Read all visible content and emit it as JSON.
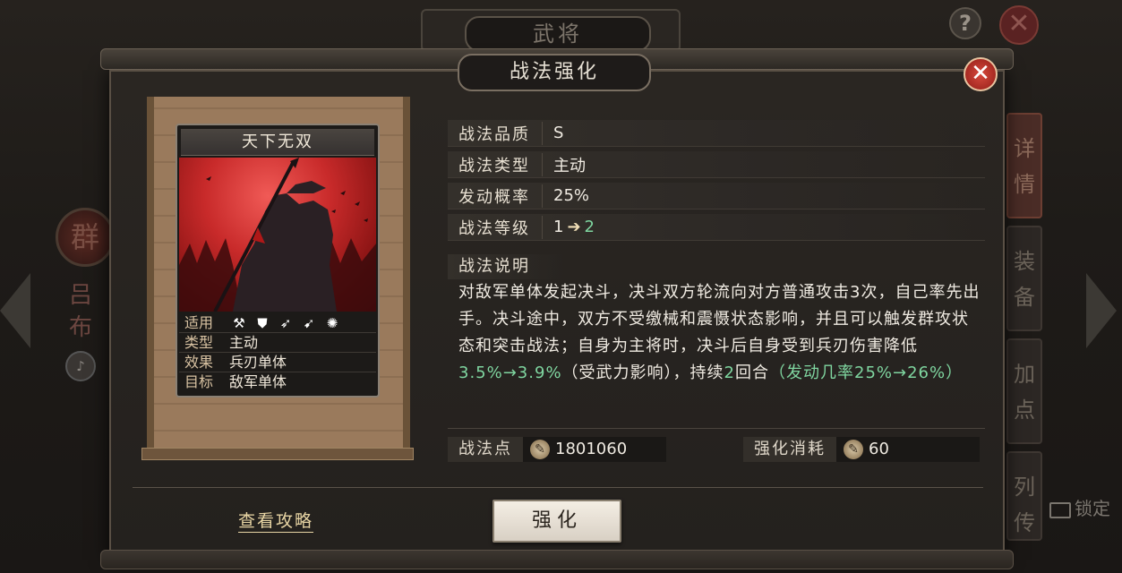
{
  "background": {
    "top_tab_title": "武将",
    "help_symbol": "?",
    "close_symbol": "✕",
    "faction": "群",
    "hero_name": "吕布",
    "side_tabs": [
      "详情",
      "装备",
      "加点",
      "列传"
    ],
    "lock_label": "锁定"
  },
  "modal": {
    "title": "战法强化",
    "close_symbol": "✕"
  },
  "card": {
    "name": "天下无双",
    "icons": [
      "axe-icon",
      "shield-icon",
      "bow-icon",
      "spear-icon",
      "wheel-icon"
    ],
    "stats": [
      {
        "key": "适用",
        "value": ""
      },
      {
        "key": "类型",
        "value": "主动"
      },
      {
        "key": "效果",
        "value": "兵刃单体"
      },
      {
        "key": "目标",
        "value": "敌军单体"
      }
    ]
  },
  "info": {
    "quality_label": "战法品质",
    "quality_value": "S",
    "type_label": "战法类型",
    "type_value": "主动",
    "rate_label": "发动概率",
    "rate_value": "25%",
    "level_label": "战法等级",
    "level_from": "1",
    "level_to": "2",
    "desc_label": "战法说明",
    "desc_part1": "对敌军单体发起决斗，决斗双方轮流向对方普通攻击3次，自己率先出手。决斗途中，双方不受缴械和震慑状态影响，并且可以触发群攻状态和突击战法；自身为主将时，决斗后自身受到兵刃伤害降低",
    "desc_green1": "3.5%→3.9%",
    "desc_part2": "（受武力影响），持续",
    "desc_green2": "2",
    "desc_part3": "回合",
    "desc_green3": "（发动几率25%→26%）"
  },
  "points": {
    "points_label": "战法点",
    "points_value": "1801060",
    "cost_label": "强化消耗",
    "cost_value": "60"
  },
  "actions": {
    "guide_link": "查看攻略",
    "enhance_button": "强化"
  },
  "colors": {
    "accent_green": "#7fd6a0",
    "close_red": "#c8342a",
    "link_gold": "#e8d5a4"
  }
}
